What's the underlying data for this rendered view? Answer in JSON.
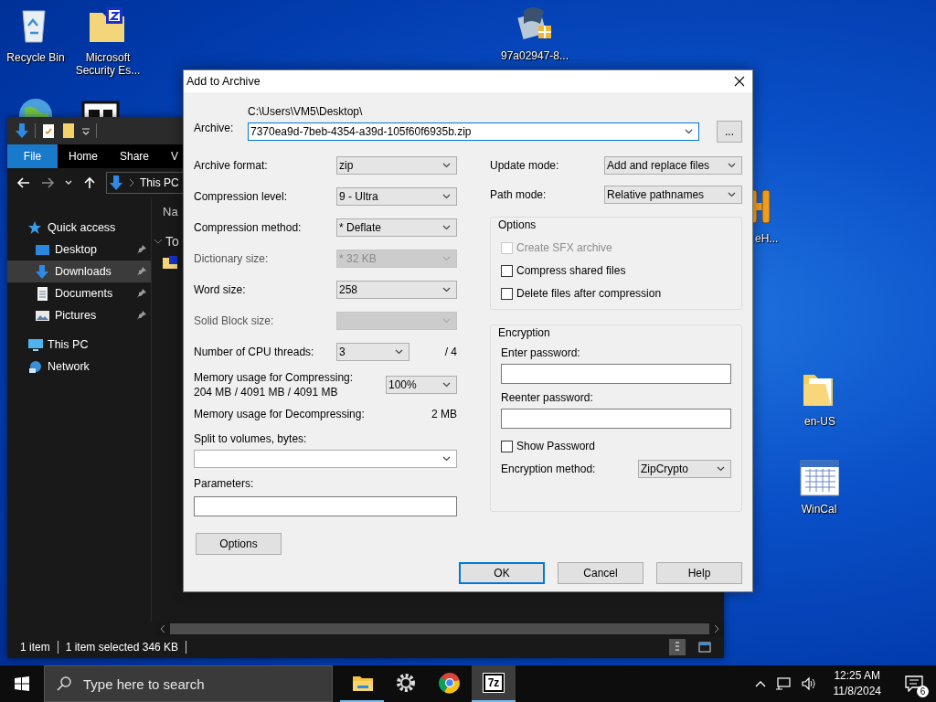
{
  "desktop_icons": [
    {
      "kind": "recycle",
      "label": "Recycle Bin"
    },
    {
      "kind": "zip-folder",
      "label": "Microsoft Security Es..."
    },
    {
      "kind": "globe"
    },
    {
      "kind": "app"
    },
    {
      "kind": "installer",
      "label": "97a02947-8..."
    },
    {
      "kind": "orange",
      "label": "eH..."
    },
    {
      "kind": "folder",
      "label": "en-US"
    },
    {
      "kind": "calendar",
      "label": "WinCal"
    }
  ],
  "explorer": {
    "ribbon_tabs": [
      {
        "label": "File",
        "selected": true
      },
      {
        "label": "Home",
        "selected": false
      },
      {
        "label": "Share",
        "selected": false
      },
      {
        "label": "V",
        "selected": false
      }
    ],
    "address": "This PC",
    "nav": [
      {
        "kind": "star",
        "label": "Quick access",
        "selected": false,
        "children": [
          {
            "kind": "desktop",
            "label": "Desktop",
            "selected": false
          },
          {
            "kind": "download",
            "label": "Downloads",
            "selected": true
          },
          {
            "kind": "document",
            "label": "Documents",
            "selected": false
          },
          {
            "kind": "pictures",
            "label": "Pictures",
            "selected": false
          }
        ]
      },
      {
        "kind": "pc",
        "label": "This PC",
        "selected": false
      },
      {
        "kind": "network",
        "label": "Network",
        "selected": false
      }
    ],
    "column_header": "Na",
    "group_header": "To",
    "status": [
      "1 item",
      "1 item selected  346 KB"
    ]
  },
  "dialog": {
    "title": "Add to Archive",
    "archive": {
      "label": "Archive:",
      "folder": "C:\\Users\\VM5\\Desktop\\",
      "value": "7370ea9d-7beb-4354-a39d-105f60f6935b.zip",
      "browse": "..."
    },
    "left": [
      {
        "kind": "combo",
        "label": "Archive format:",
        "value": "zip",
        "disabled": false
      },
      {
        "kind": "combo",
        "label": "Compression level:",
        "value": "9 - Ultra",
        "disabled": false
      },
      {
        "kind": "combo",
        "label": "Compression method:",
        "value": "* Deflate",
        "disabled": false
      },
      {
        "kind": "combo",
        "label": "Dictionary size:",
        "value": "* 32 KB",
        "disabled": true
      },
      {
        "kind": "combo",
        "label": "Word size:",
        "value": "258",
        "disabled": false
      },
      {
        "kind": "combo",
        "label": "Solid Block size:",
        "disabled": true
      },
      {
        "kind": "threads",
        "label": "Number of CPU threads:",
        "value": "3",
        "note": "/ 4",
        "disabled": false
      },
      {
        "kind": "memory",
        "label": "Memory usage for Compressing:",
        "detail": "204 MB / 4091 MB / 4091 MB",
        "value": "100%",
        "disabled": false
      },
      {
        "kind": "info",
        "label": "Memory usage for Decompressing:",
        "value": "2 MB"
      },
      {
        "kind": "wide-combo",
        "label": "Split to volumes, bytes:",
        "disabled": false
      },
      {
        "kind": "text",
        "label": "Parameters:"
      }
    ],
    "options_button": "Options",
    "right": [
      {
        "label": "Update mode:",
        "value": "Add and replace files"
      },
      {
        "label": "Path mode:",
        "value": "Relative pathnames"
      }
    ],
    "options_group": {
      "title": "Options",
      "items": [
        {
          "label": "Create SFX archive",
          "checked": false,
          "disabled": true
        },
        {
          "label": "Compress shared files",
          "checked": false,
          "disabled": false
        },
        {
          "label": "Delete files after compression",
          "checked": false,
          "disabled": false
        }
      ]
    },
    "encryption": {
      "title": "Encryption",
      "password_label": "Enter password:",
      "reenter_label": "Reenter password:",
      "show": {
        "label": "Show Password",
        "checked": false
      },
      "method_label": "Encryption method:",
      "method": "ZipCrypto"
    },
    "buttons": [
      {
        "label": "OK",
        "default": true
      },
      {
        "label": "Cancel",
        "default": false
      },
      {
        "label": "Help",
        "default": false
      }
    ]
  },
  "taskbar": {
    "search_placeholder": "Type here to search",
    "apps": [
      {
        "kind": "explorer",
        "running": true,
        "active": false
      },
      {
        "kind": "settings",
        "running": false,
        "active": false
      },
      {
        "kind": "chrome",
        "running": false,
        "active": false
      },
      {
        "kind": "archiver",
        "label": "7z",
        "running": true,
        "active": true
      }
    ],
    "time": "12:25 AM",
    "date": "11/8/2024",
    "notifications": "6"
  }
}
